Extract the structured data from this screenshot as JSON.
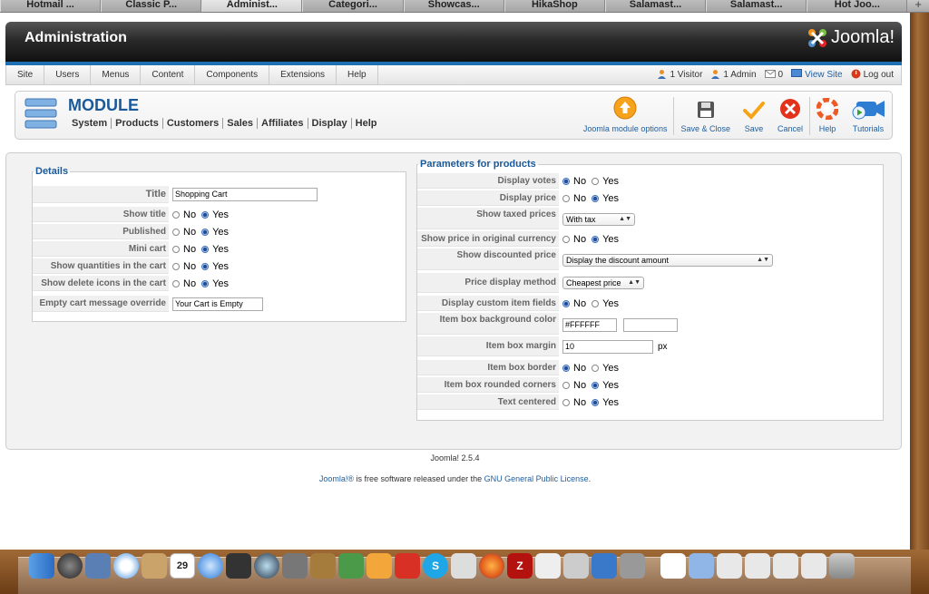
{
  "browser_tabs": [
    "Hotmail ...",
    "Classic P...",
    "Administ...",
    "Categori...",
    "Showcas...",
    "HikaShop",
    "Salamast...",
    "Salamast...",
    "Hot Joo..."
  ],
  "header": {
    "title": "Administration",
    "logo_text": "Joomla!"
  },
  "menu": {
    "items": [
      "Site",
      "Users",
      "Menus",
      "Content",
      "Components",
      "Extensions",
      "Help"
    ]
  },
  "status": {
    "visitors": "1 Visitor",
    "admins": "1 Admin",
    "messages": "0",
    "view_site": "View Site",
    "logout": "Log out"
  },
  "module": {
    "title": "MODULE",
    "submenu": [
      "System",
      "Products",
      "Customers",
      "Sales",
      "Affiliates",
      "Display",
      "Help"
    ]
  },
  "toolbar": {
    "options": "Joomla module options",
    "save_close": "Save & Close",
    "save": "Save",
    "cancel": "Cancel",
    "help": "Help",
    "tutorials": "Tutorials"
  },
  "details": {
    "legend": "Details",
    "title_label": "Title",
    "title_value": "Shopping Cart",
    "show_title": "Show title",
    "published": "Published",
    "mini_cart": "Mini cart",
    "show_quantities": "Show quantities in the cart",
    "show_delete": "Show delete icons in the cart",
    "empty_msg_label": "Empty cart message override",
    "empty_msg_value": "Your Cart is Empty"
  },
  "params": {
    "legend": "Parameters for products",
    "display_votes": "Display votes",
    "display_price": "Display price",
    "show_taxed": "Show taxed prices",
    "taxed_value": "With tax",
    "show_original": "Show price in original currency",
    "show_discounted": "Show discounted price",
    "discounted_value": "Display the discount amount",
    "price_method": "Price display method",
    "price_method_value": "Cheapest price",
    "custom_fields": "Display custom item fields",
    "bg_color": "Item box background color",
    "bg_color_value": "#FFFFFF",
    "margin": "Item box margin",
    "margin_value": "10",
    "margin_unit": "px",
    "border": "Item box border",
    "rounded": "Item box rounded corners",
    "centered": "Text centered"
  },
  "radio_labels": {
    "no": "No",
    "yes": "Yes"
  },
  "footer": {
    "version": "Joomla! 2.5.4",
    "joomla_link": "Joomla!®",
    "text": " is free software released under the ",
    "license_link": "GNU General Public License",
    "end": "."
  },
  "dock": {
    "calendar_day": "29"
  },
  "colors": {
    "accent": "#1a5a9a",
    "header_bar": "#1f6fb3"
  }
}
